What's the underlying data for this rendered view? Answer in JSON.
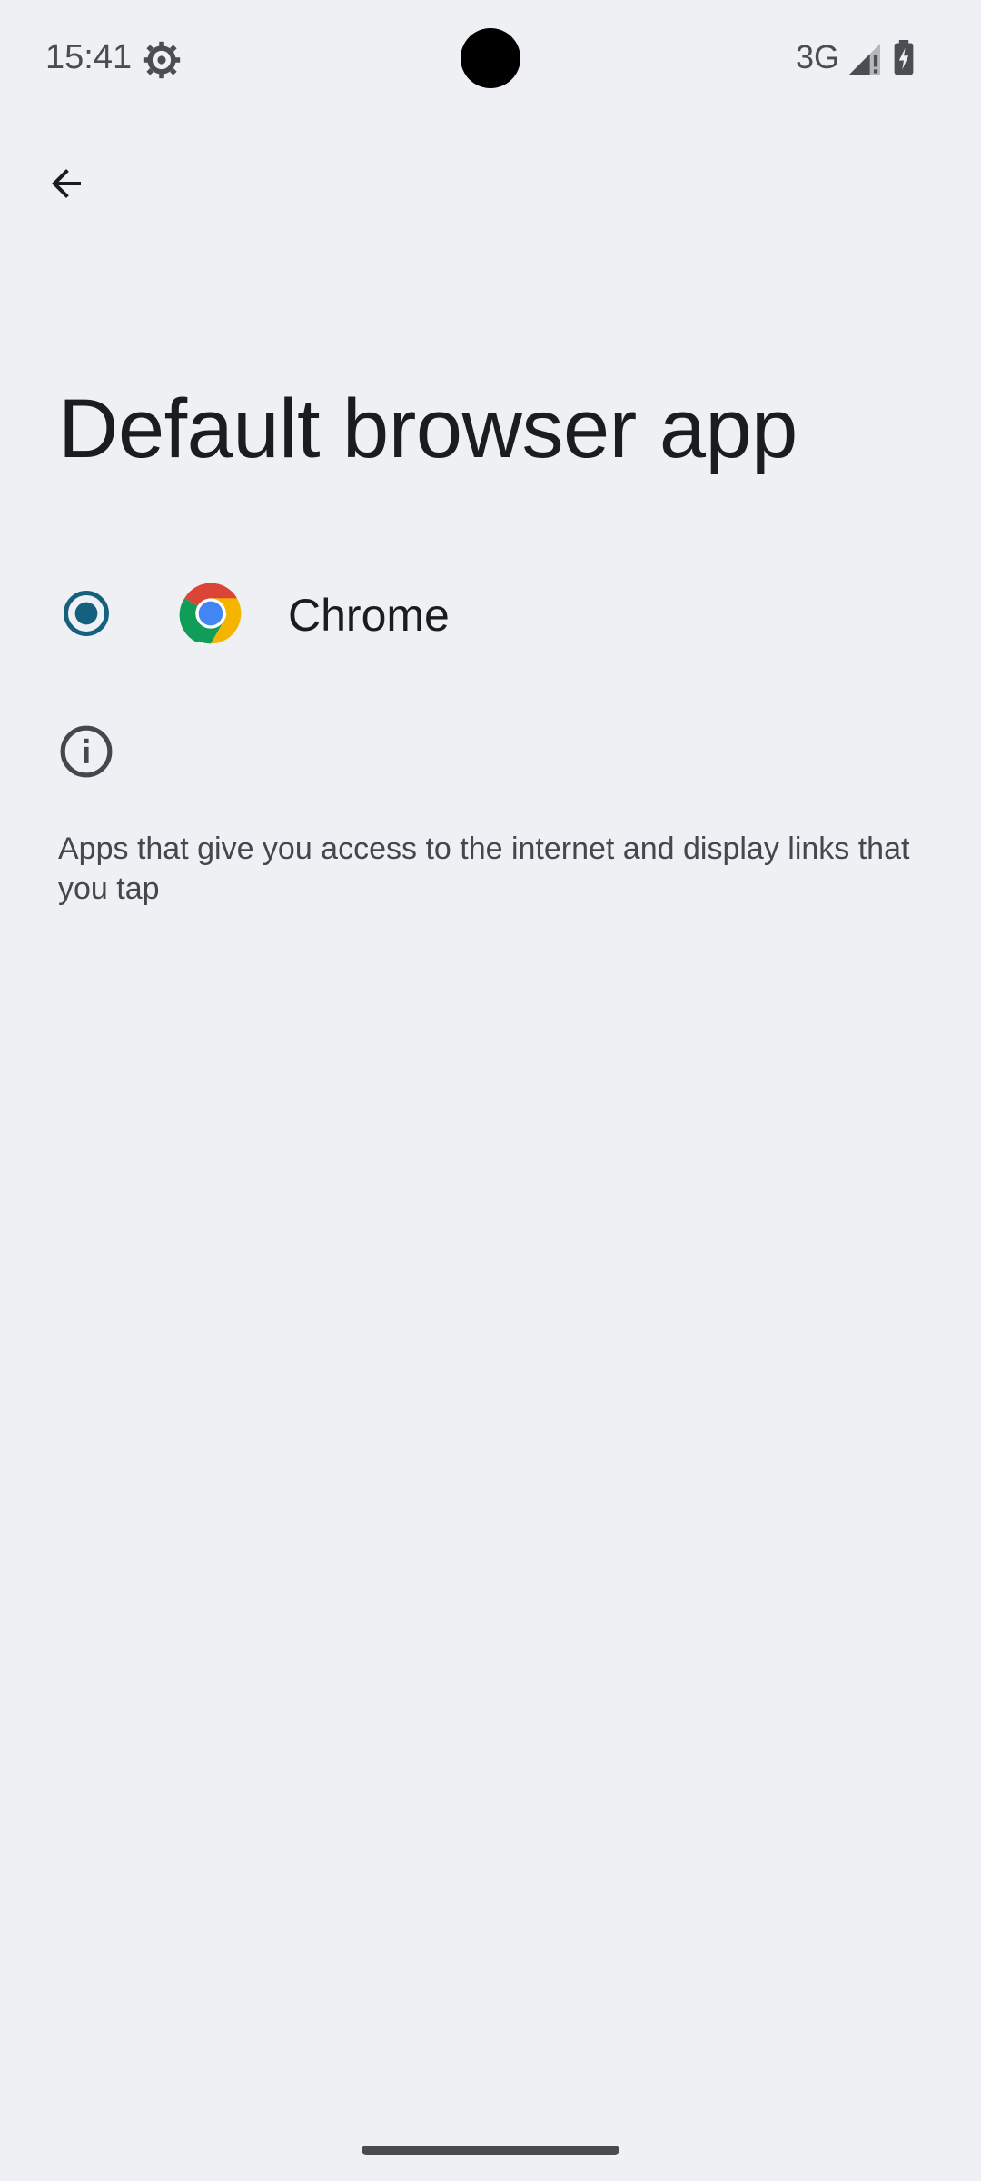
{
  "status_bar": {
    "time": "15:41",
    "network": "3G",
    "icons": [
      "settings-gear-icon",
      "signal-icon",
      "battery-charging-icon"
    ]
  },
  "toolbar": {
    "back_icon": "arrow-back-icon"
  },
  "page": {
    "title": "Default browser app"
  },
  "apps": [
    {
      "name": "Chrome",
      "selected": true,
      "icon": "chrome-logo-icon"
    }
  ],
  "info": {
    "icon": "info-icon",
    "text": "Apps that give you access to the internet and display links that you tap"
  },
  "colors": {
    "background": "#eff0f3",
    "radio_selected": "#16607f",
    "text_primary": "#1b1c1f",
    "text_secondary": "#44474e"
  }
}
